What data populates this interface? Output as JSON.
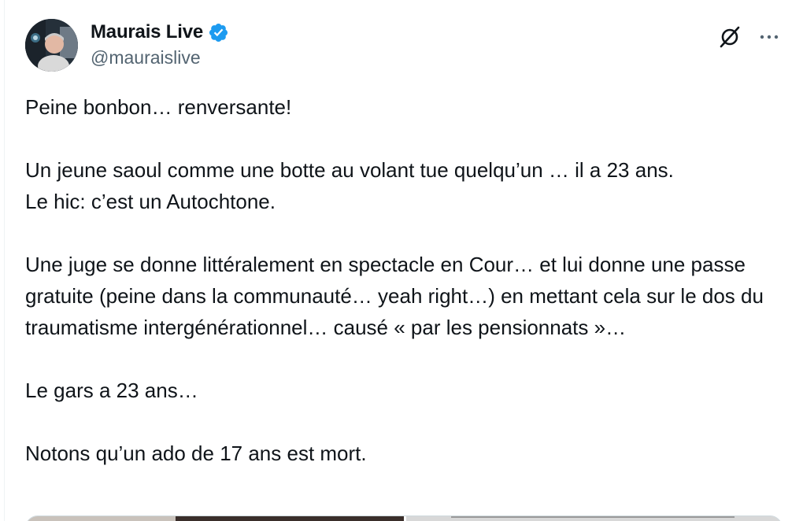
{
  "author": {
    "display_name": "Maurais Live",
    "handle": "@mauraislive",
    "verified": true
  },
  "icons": {
    "avatar": "avatar",
    "verified": "verified-badge-icon",
    "grok": "grok-icon",
    "more": "more-options-icon"
  },
  "colors": {
    "verified_blue": "#1d9bf0",
    "text_primary": "#0f1419",
    "text_secondary": "#536471"
  },
  "tweet": {
    "p1": "Peine bonbon… renversante!",
    "p2a": "Un jeune saoul comme une botte au volant tue quelqu’un … il a 23 ans.",
    "p2b": "Le hic: c’est un Autochtone.",
    "p3": "Une juge se donne littéralement en spectacle en Cour… et lui donne une passe gratuite (peine dans la communauté… yeah right…) en mettant cela sur le dos du traumatisme intergénérationnel… causé « par les pensionnats »…",
    "p4": "Le gars a 23 ans…",
    "p5": "Notons qu’un ado de 17 ans est mort."
  }
}
